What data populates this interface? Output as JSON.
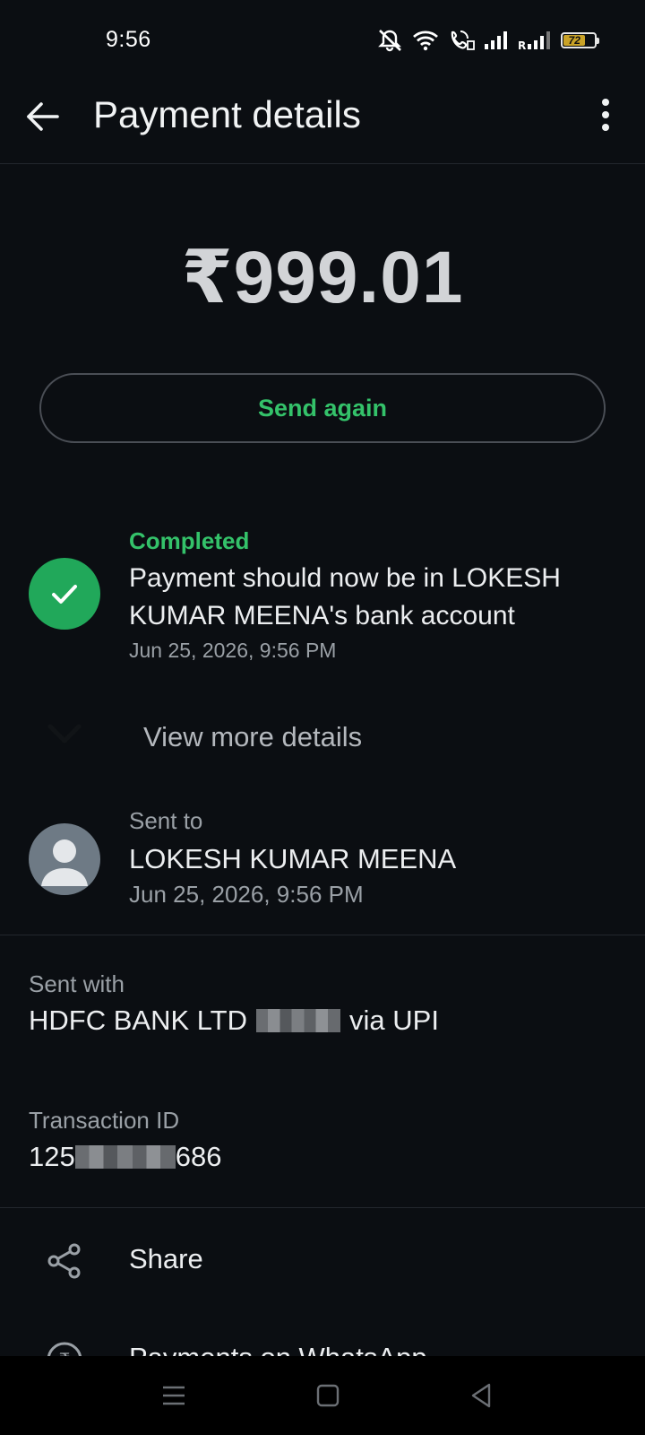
{
  "status_bar": {
    "time": "9:56",
    "battery": "72",
    "icons": [
      "silent-icon",
      "wifi-icon",
      "volte-call-icon",
      "signal-icon",
      "roaming-signal-icon",
      "battery-icon"
    ]
  },
  "header": {
    "title": "Payment details",
    "back_icon": "arrow-left-icon",
    "more_icon": "more-vertical-icon"
  },
  "payment": {
    "amount": "₹999.01",
    "send_again_label": "Send again"
  },
  "status": {
    "label": "Completed",
    "message": "Payment should now be in LOKESH KUMAR MEENA's bank account",
    "date": "Jun 25, 2026, 9:56 PM",
    "color": "#34c26a"
  },
  "view_more": {
    "label": "View more details"
  },
  "recipient": {
    "label": "Sent to",
    "name": "LOKESH KUMAR MEENA",
    "date": "Jun 25, 2026, 9:56 PM"
  },
  "sent_with": {
    "label": "Sent with",
    "bank": "HDFC BANK LTD",
    "suffix": "via UPI"
  },
  "transaction": {
    "label": "Transaction ID",
    "prefix": "125",
    "suffix": "686"
  },
  "actions": {
    "share_label": "Share",
    "whatsapp_label": "Payments on WhatsApp"
  },
  "colors": {
    "background": "#0b0e12",
    "accent_green": "#34c26a",
    "check_green": "#21a85a"
  }
}
